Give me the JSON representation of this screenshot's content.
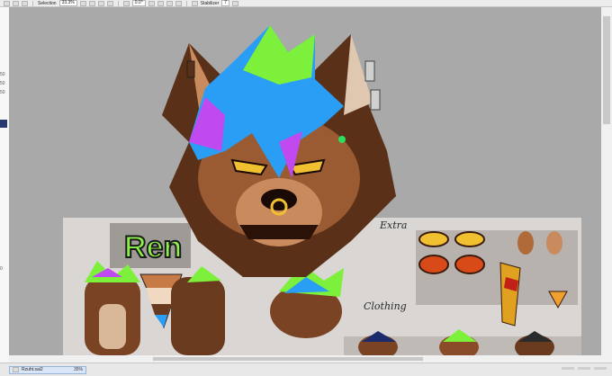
{
  "toolbar": {
    "selection_label": "Selection",
    "zoom_value": "33.3%",
    "rotation_value": "0.0°",
    "stabilizer_label": "Stabilizer",
    "stabilizer_value": "7"
  },
  "left_panel": {
    "values": [
      "50",
      "50",
      "50",
      "0"
    ]
  },
  "canvas": {
    "artwork_text": "Ren",
    "extra_label": "Extra",
    "clothing_label": "Clothing"
  },
  "status_bar": {
    "file_name": "Rzuht.sai2",
    "zoom": "35%"
  },
  "colors": {
    "canvas_bg": "#a9a9a9",
    "sheet_bg": "#d9d6d3",
    "fur_dark": "#5a3018",
    "fur_main": "#9a5a32",
    "fur_light": "#c98a5e",
    "accent_hair_green": "#7df03c",
    "accent_hair_blue": "#2a9df4",
    "accent_hair_purple": "#c04af0"
  },
  "icons": [
    "rect-select-icon",
    "lasso-icon",
    "magic-wand-icon",
    "hand-icon",
    "rotate-icon",
    "pen-icon",
    "file-icon"
  ]
}
